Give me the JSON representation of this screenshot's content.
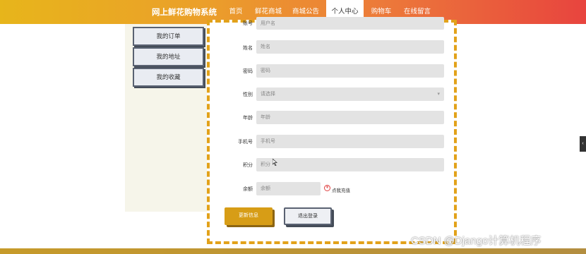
{
  "header": {
    "site_title": "网上鲜花购物系统",
    "nav": [
      {
        "label": "首页",
        "active": false
      },
      {
        "label": "鲜花商城",
        "active": false
      },
      {
        "label": "商城公告",
        "active": false
      },
      {
        "label": "个人中心",
        "active": true
      },
      {
        "label": "购物车",
        "active": false
      },
      {
        "label": "在线留言",
        "active": false
      }
    ]
  },
  "sidebar": {
    "items": [
      {
        "label": "我的订单"
      },
      {
        "label": "我的地址"
      },
      {
        "label": "我的收藏"
      }
    ]
  },
  "form": {
    "fields": [
      {
        "label": "账号",
        "placeholder": "用户名"
      },
      {
        "label": "姓名",
        "placeholder": "姓名"
      },
      {
        "label": "密码",
        "placeholder": "密码"
      },
      {
        "label": "性别",
        "placeholder": "请选择"
      },
      {
        "label": "年龄",
        "placeholder": "年龄"
      },
      {
        "label": "手机号",
        "placeholder": "手机号"
      },
      {
        "label": "积分",
        "placeholder": "积分"
      },
      {
        "label": "余额",
        "placeholder": "余额"
      }
    ],
    "recharge_text": "点我充值",
    "update_button": "更新信息",
    "logout_button": "退出登录"
  },
  "watermark": "CSDN @Django计算机程序",
  "colors": {
    "nav_gradient_start": "#e7b51b",
    "nav_gradient_end": "#e8443e",
    "frame_dash": "#e2a21a",
    "update_button": "#d79d16"
  }
}
